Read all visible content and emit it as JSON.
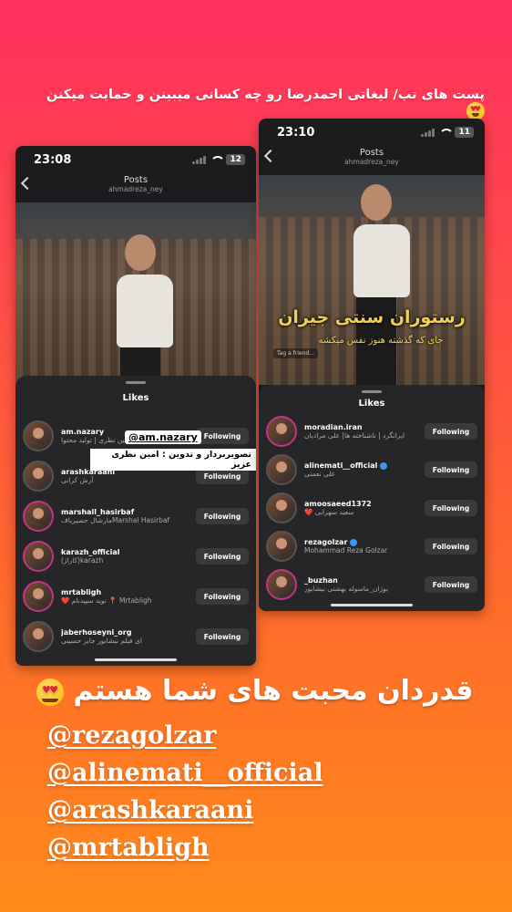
{
  "caption": "پست های تب/ لیغاتی احمدرضا رو چه کسانی میبینن و حمایت میکنن",
  "left_phone": {
    "time": "23:08",
    "battery": "12",
    "nav_title": "Posts",
    "nav_sub": "ahmadreza_ney",
    "sheet_title": "Likes",
    "mention_tag": "@am.nazary",
    "credit_text": "تصویربردار و تدوین : امین نظری عزیز",
    "rows": [
      {
        "username": "am.nazary",
        "fullname": "امین نظری | تولید محتوا",
        "button": "Following"
      },
      {
        "username": "arashkaraani",
        "fullname": "آرش کرانی",
        "button": "Following"
      },
      {
        "username": "marshall_hasirbaf",
        "fullname": "Marshal Hasirbafمارشال حصیرباف",
        "button": "Following"
      },
      {
        "username": "karazh_official",
        "fullname": "karazh(کاراژ)",
        "button": "Following"
      },
      {
        "username": "mrtabligh",
        "fullname": "Mrtabligh 📍 نوید سپیدنام ❤️",
        "button": "Following"
      },
      {
        "username": "jaberhoseyni_org",
        "fullname": "ای فیلم نیشابور جابر حسینی",
        "button": "Following"
      }
    ]
  },
  "right_phone": {
    "time": "23:10",
    "battery": "11",
    "nav_title": "Posts",
    "nav_sub": "ahmadreza_ney",
    "overlay_title": "رستوران سنتی جیران",
    "overlay_sub": "جای که گذشته هنوز نفس میکشه",
    "tag_hint": "Tag a friend...",
    "sheet_title": "Likes",
    "rows": [
      {
        "username": "moradian.iran",
        "fullname": "ایرانگرد | ناشناخته ها| علی مرادیان",
        "button": "Following",
        "verified": false
      },
      {
        "username": "alinemati__official",
        "fullname": "علی نعمتی",
        "button": "Following",
        "verified": true
      },
      {
        "username": "amoosaeed1372",
        "fullname": "سعید سهرابی ❤️",
        "button": "Following",
        "verified": false
      },
      {
        "username": "rezagolzar",
        "fullname": "Mohammad Reza Golzar",
        "button": "Following",
        "verified": true
      },
      {
        "username": "_buzhan",
        "fullname": "بوژان_ماسوله بهشتی نیشابور",
        "button": "Following",
        "verified": false
      }
    ]
  },
  "thanks_text": "قدردان محبت های شما هستم",
  "mentions": [
    "@rezagolzar",
    "@alinemati__official",
    "@arashkaraani",
    "@mrtabligh"
  ]
}
